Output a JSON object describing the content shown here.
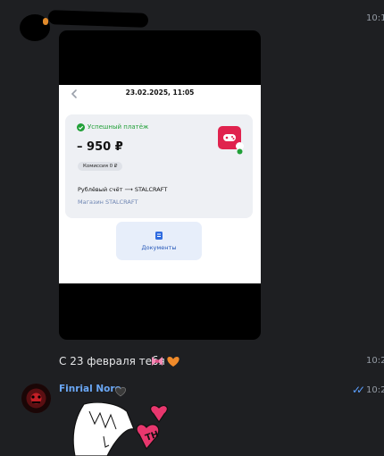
{
  "message_1": {
    "time": "10:1",
    "attachment": {
      "date": "23.02.2025, 11:05",
      "status": "Успешный платёж",
      "amount": "– 950 ₽",
      "fee": "Комиссия 0 ₽",
      "transfer": "Рублёвый счёт ⟶ STALCRAFT",
      "shop": "Магазин STALCRAFT",
      "documents_label": "Документы"
    }
  },
  "message_2": {
    "text": "С 23 февраля тебя",
    "emoji": "🎀🧡",
    "time": "10:2"
  },
  "message_3": {
    "sender": "Finrial Noro",
    "sender_badge": "🖤",
    "time": "10:2",
    "sticker_text": "TH"
  },
  "colors": {
    "background": "#1e1f22",
    "sender_name": "#6aa7f5",
    "read_check": "#5ca0ff",
    "success_green": "#21a038",
    "app_red": "#e0234e"
  }
}
